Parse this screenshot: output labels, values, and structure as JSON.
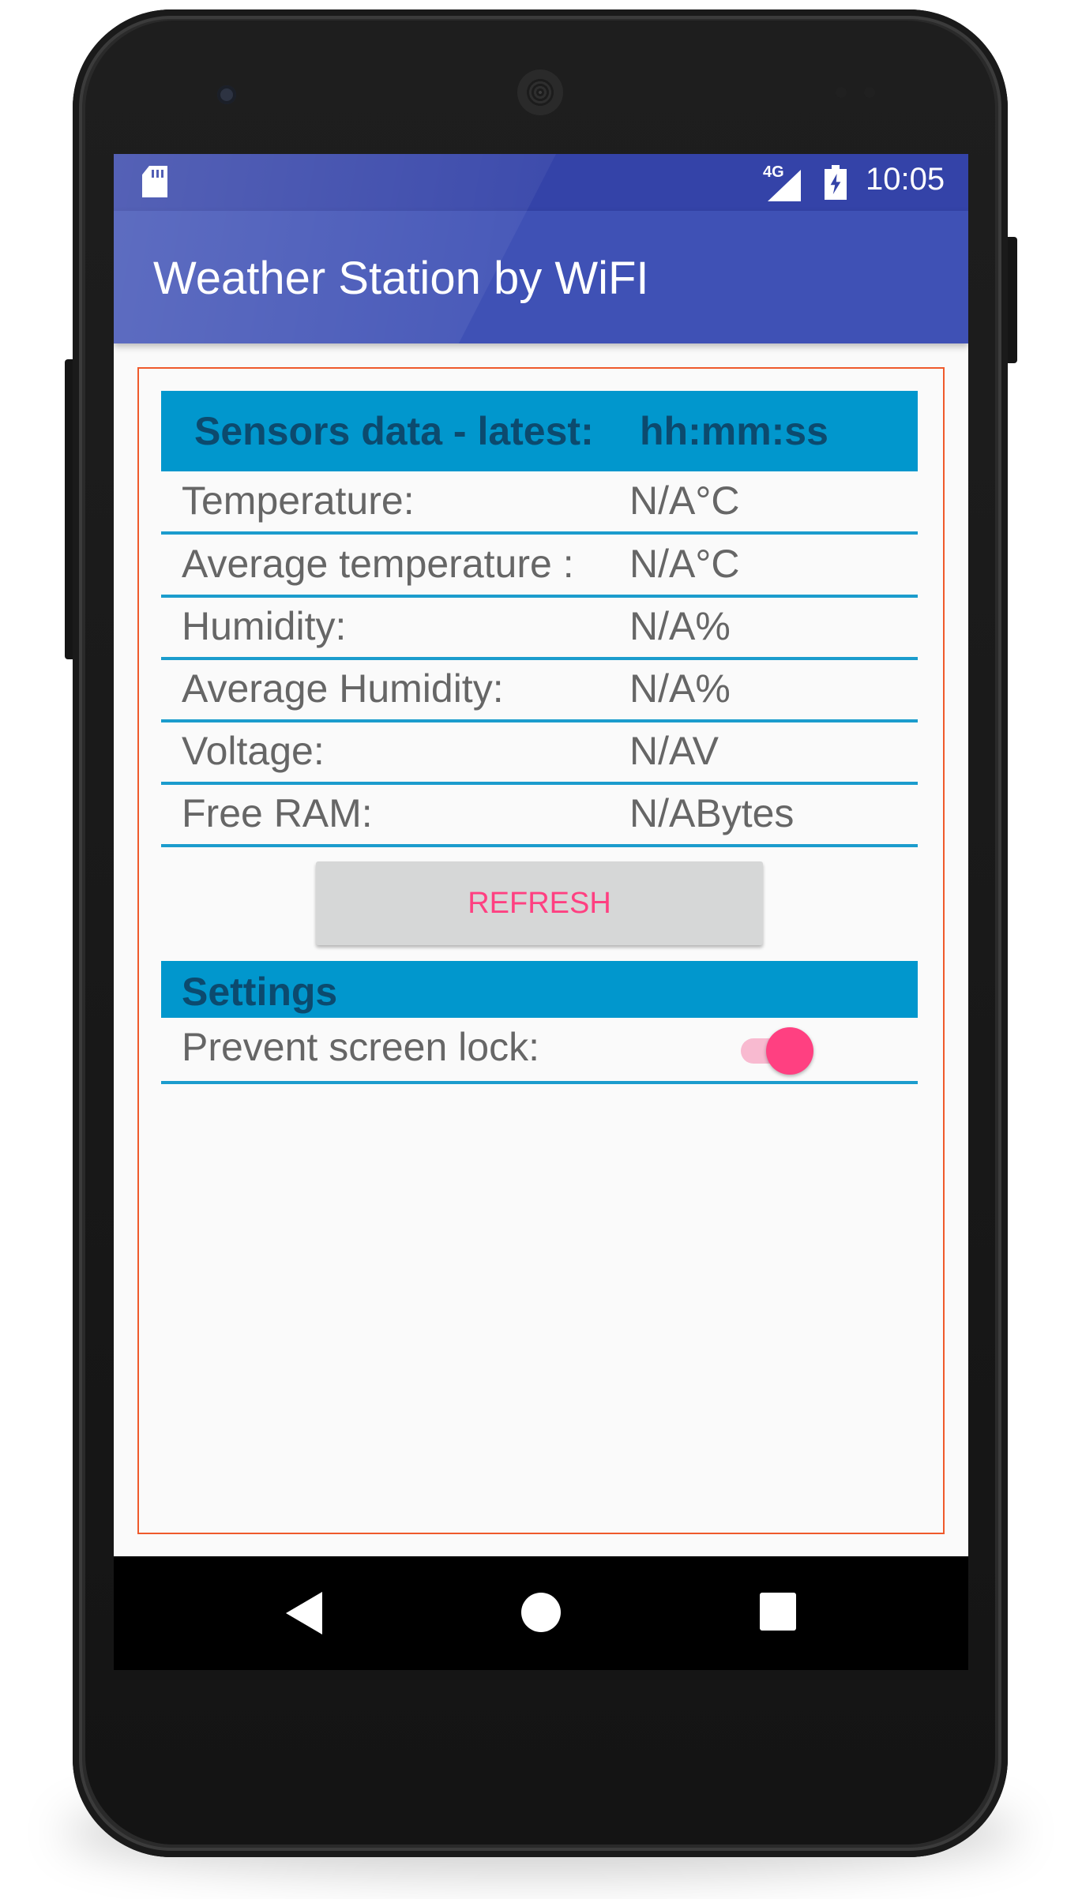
{
  "status_bar": {
    "network_label": "4G",
    "time": "10:05"
  },
  "app_bar": {
    "title": "Weather Station by WiFI"
  },
  "sensors": {
    "header_label": "Sensors data - latest:",
    "header_time": "hh:mm:ss",
    "rows": [
      {
        "label": "Temperature:",
        "value": "N/A°C"
      },
      {
        "label": "Average temperature :",
        "value": "N/A°C"
      },
      {
        "label": "Humidity:",
        "value": "N/A%"
      },
      {
        "label": "Average Humidity:",
        "value": "N/A%"
      },
      {
        "label": "Voltage:",
        "value": "N/AV"
      },
      {
        "label": "Free RAM:",
        "value": "N/ABytes"
      }
    ]
  },
  "refresh_label": "REFRESH",
  "settings": {
    "header": "Settings",
    "prevent_screen_lock": {
      "label": "Prevent screen lock:",
      "enabled": true
    }
  },
  "colors": {
    "status_bar": "#3443a8",
    "app_bar": "#3f51b5",
    "header_row": "#0197cd",
    "accent": "#ff4081",
    "frame_border": "#ef5a2c"
  },
  "icons": [
    "sd-card-icon",
    "signal-icon",
    "battery-charging-icon",
    "back-icon",
    "home-icon",
    "recents-icon"
  ]
}
